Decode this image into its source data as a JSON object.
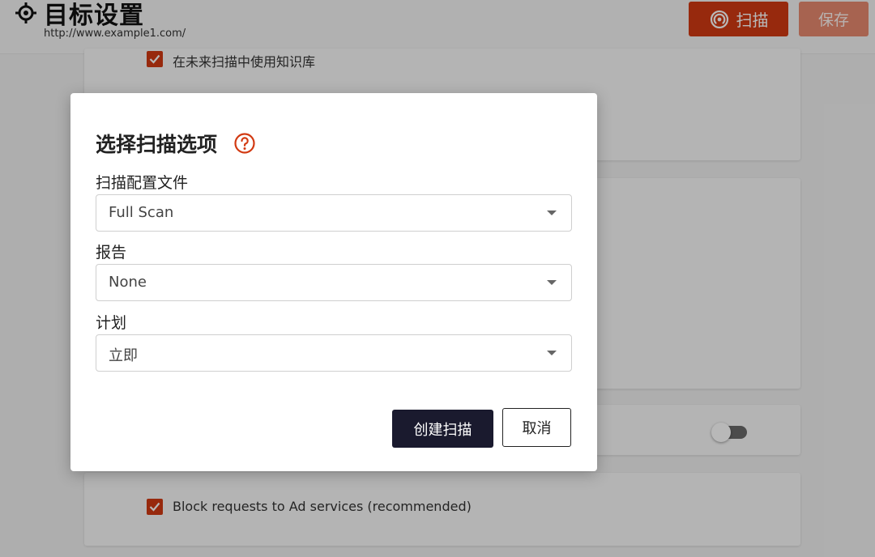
{
  "header": {
    "title": "目标设置",
    "url": "http://www.example1.com/",
    "scan_label": "扫描",
    "save_label": "保存"
  },
  "background": {
    "knowledge_base_label": "在未来扫描中使用知识库",
    "knowledge_base_checked": true,
    "block_ads_label": "Block requests to Ad services (recommended)",
    "block_ads_checked": true,
    "toggle_on": false
  },
  "modal": {
    "title": "选择扫描选项",
    "fields": [
      {
        "label": "扫描配置文件",
        "value": "Full Scan"
      },
      {
        "label": "报告",
        "value": "None"
      },
      {
        "label": "计划",
        "value": "立即"
      }
    ],
    "create_label": "创建扫描",
    "cancel_label": "取消"
  },
  "colors": {
    "accent": "#d23a12",
    "save_disabled": "#e88a6f",
    "primary_dark": "#1a1a2e"
  },
  "icons": {
    "title": "target-icon",
    "scan": "radar-icon",
    "help": "help-circle-icon",
    "checkbox": "check-icon",
    "dropdown": "caret-down-icon"
  }
}
